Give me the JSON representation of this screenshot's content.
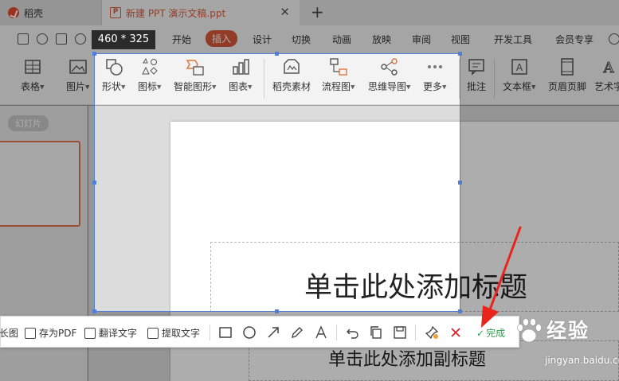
{
  "tabs": {
    "home_label": "稻壳",
    "doc_title": "新建 PPT 演示文稿.ppt",
    "doc_icon_letter": "P"
  },
  "menu": {
    "items": [
      "开始",
      "插入",
      "设计",
      "切换",
      "动画",
      "放映",
      "审阅",
      "视图",
      "开发工具",
      "会员专享"
    ],
    "active": "插入"
  },
  "ribbon": {
    "items": [
      {
        "label": "表格",
        "icon": "table-icon",
        "dropdown": true
      },
      {
        "label": "图片",
        "icon": "image-icon",
        "dropdown": true
      },
      {
        "label": "形状",
        "icon": "shapes-icon",
        "dropdown": true
      },
      {
        "label": "图标",
        "icon": "icons-icon",
        "dropdown": true
      },
      {
        "label": "智能图形",
        "icon": "smartart-icon",
        "dropdown": true
      },
      {
        "label": "图表",
        "icon": "chart-icon",
        "dropdown": true
      },
      {
        "label": "稻壳素材",
        "icon": "material-icon",
        "dropdown": false
      },
      {
        "label": "流程图",
        "icon": "flowchart-icon",
        "dropdown": true
      },
      {
        "label": "思维导图",
        "icon": "mindmap-icon",
        "dropdown": true
      },
      {
        "label": "更多",
        "icon": "more-icon",
        "dropdown": true
      },
      {
        "label": "批注",
        "icon": "comment-icon",
        "dropdown": false
      },
      {
        "label": "文本框",
        "icon": "textbox-icon",
        "dropdown": true
      },
      {
        "label": "页眉页脚",
        "icon": "header-footer-icon",
        "dropdown": false
      },
      {
        "label": "艺术字",
        "icon": "wordart-icon",
        "dropdown": false
      }
    ]
  },
  "panel": {
    "slides_label": "幻灯片"
  },
  "slide": {
    "title_placeholder": "单击此处添加标题",
    "subtitle_placeholder": "单击此处添加副标题"
  },
  "capture": {
    "size_label": "460 * 325",
    "long_label": "长图",
    "save_pdf_label": "存为PDF",
    "translate_label": "翻译文字",
    "extract_label": "提取文字",
    "done_label": "完成"
  },
  "watermark": {
    "title": "经验",
    "url": "jingyan.baidu.com"
  },
  "colors": {
    "accent": "#d8593b",
    "selection": "#4f7fd8",
    "cancel": "#e02020",
    "done": "#2e9e4f",
    "arrow": "#e8241c"
  }
}
